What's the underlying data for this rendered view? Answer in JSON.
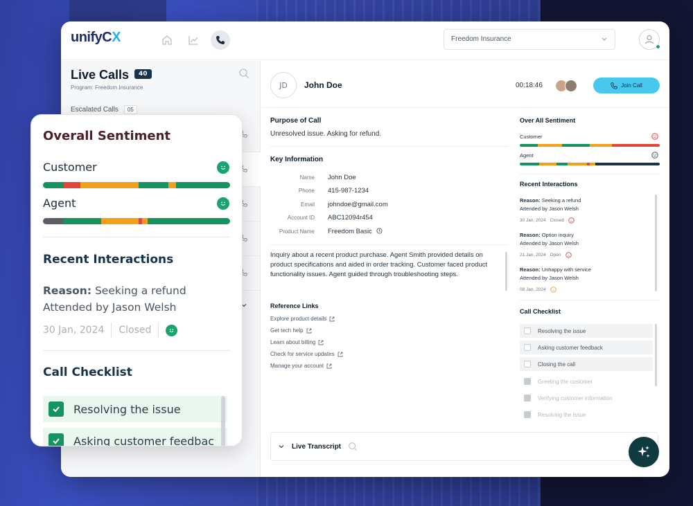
{
  "app": {
    "logo_text": "unify",
    "logo_cx_c": "C",
    "logo_cx_x": "X"
  },
  "header": {
    "nav_icons": [
      "home-icon",
      "chart-icon",
      "phone-icon"
    ],
    "program_select": "Freedom Insurance"
  },
  "live_calls": {
    "title": "Live Calls",
    "count": "40",
    "program_label": "Program: Freedom Insurance",
    "escalated_label": "Escalated Calls",
    "escalated_count": "05"
  },
  "call": {
    "initials": "JD",
    "customer_name": "John Doe",
    "duration": "00:18:46",
    "join_label": "Join Call"
  },
  "purpose": {
    "title": "Purpose of Call",
    "text": "Unresolved issue. Asking for refund."
  },
  "key_info": {
    "title": "Key Information",
    "rows": [
      {
        "key": "Name",
        "value": "John Doe"
      },
      {
        "key": "Phone",
        "value": "415-987-1234"
      },
      {
        "key": "Email",
        "value": "johndoe@gmail.com"
      },
      {
        "key": "Account ID",
        "value": "ABC12094r454"
      },
      {
        "key": "Product Name",
        "value": "Freedom Basic"
      }
    ]
  },
  "summary": "Inquiry about a recent product purchase. Agent Smith provided details on product specifications and aided in order tracking. Customer faced product functionality issues. Agent guided through troubleshooting steps.",
  "reference_links": {
    "title": "Reference Links",
    "items": [
      "Explore product details",
      "Get tech help",
      "Learn about billing",
      "Check for service updates",
      "Manage your account"
    ]
  },
  "sentiment_panel": {
    "title": "Over All Sentiment",
    "customer_label": "Customer",
    "agent_label": "Agent"
  },
  "recent_panel": {
    "title": "Recent Interactions",
    "items": [
      {
        "reason_label": "Reason:",
        "reason": "Seeking a refund",
        "attended": "Attended by Jason Welsh",
        "date": "30 Jan, 2024",
        "status": "Closed"
      },
      {
        "reason_label": "Reason:",
        "reason": "Option inquiry",
        "attended": "Attended by Jason Welsh",
        "date": "21 Jan, 2024",
        "status": "Open"
      },
      {
        "reason_label": "Reason:",
        "reason": "Unhappy with service",
        "attended": "Attended by Jason Welsh",
        "date": "08 Jan, 2024",
        "status": ""
      }
    ]
  },
  "checklist_panel": {
    "title": "Call Checklist",
    "items": [
      {
        "label": "Resolving the issue",
        "done": false
      },
      {
        "label": "Asking customer feedback",
        "done": false
      },
      {
        "label": "Closing the call",
        "done": false
      },
      {
        "label": "Greeting the customer",
        "done": true
      },
      {
        "label": "Verifying customer information",
        "done": true
      },
      {
        "label": "Resolving the issue",
        "done": true
      }
    ]
  },
  "transcript": {
    "label": "Live Transcript"
  },
  "card": {
    "title": "Overall Sentiment",
    "customer_label": "Customer",
    "agent_label": "Agent",
    "recent_title": "Recent Interactions",
    "reason_label": "Reason:",
    "reason": "Seeking a refund",
    "attended": "Attended by Jason Welsh",
    "date": "30 Jan, 2024",
    "status": "Closed",
    "checklist_title": "Call Checklist",
    "checklist": [
      "Resolving the issue",
      "Asking customer feedbac"
    ]
  },
  "colors": {
    "green": "#16945f",
    "orange": "#f2a01a",
    "red": "#e0463a",
    "grey": "#5b5f66",
    "accent": "#49c8ef",
    "navy": "#17324a"
  }
}
